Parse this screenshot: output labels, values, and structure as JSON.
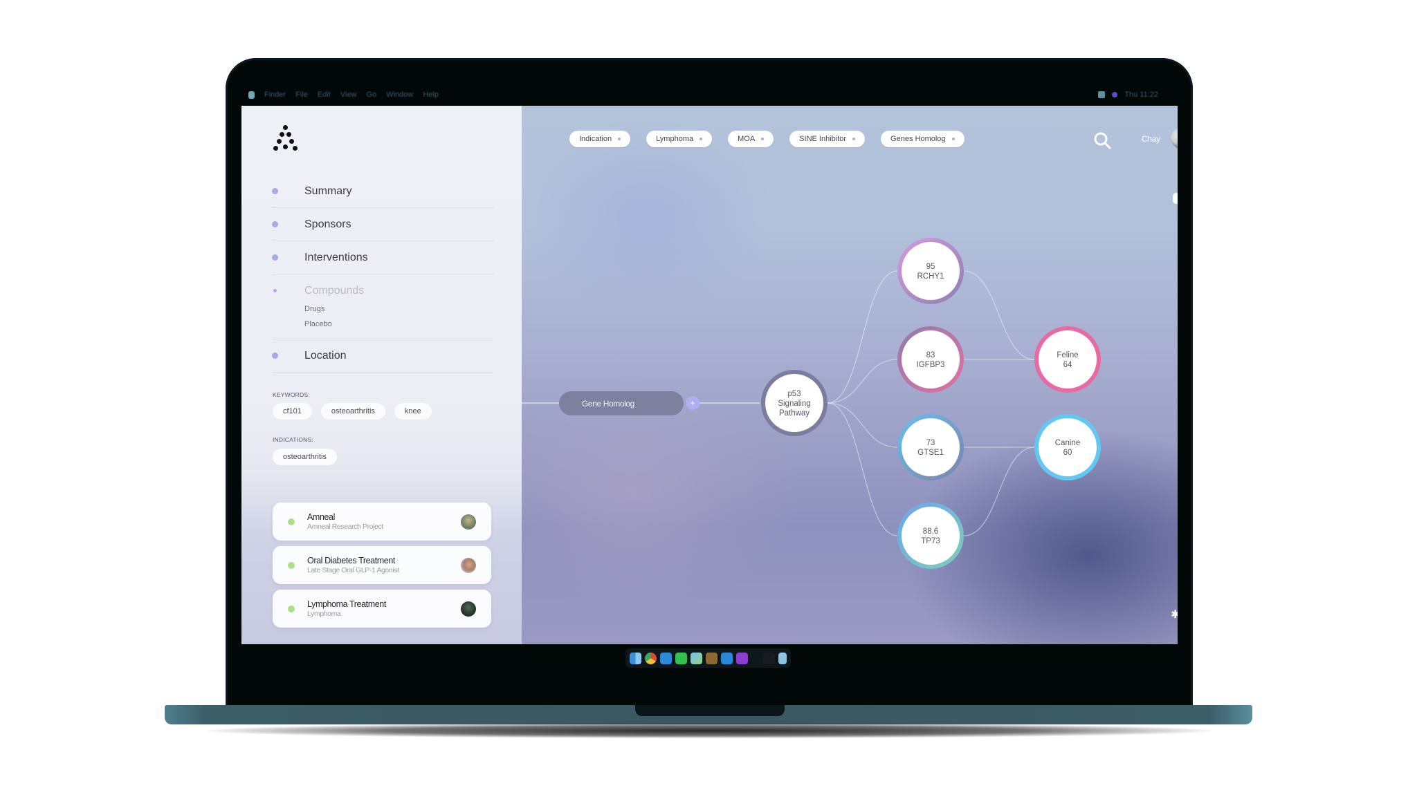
{
  "menubar": {
    "items": [
      "Finder",
      "File",
      "Edit",
      "View",
      "Go",
      "Window",
      "Help"
    ],
    "clock": "Thu 11:22"
  },
  "sidebar": {
    "logo": "dots-triangle-logo",
    "nav": [
      {
        "label": "Summary",
        "active": true
      },
      {
        "label": "Sponsors",
        "active": true
      },
      {
        "label": "Interventions",
        "active": true
      },
      {
        "label": "Compounds",
        "active": false,
        "children": [
          "Drugs",
          "Placebo"
        ]
      },
      {
        "label": "Location",
        "active": true
      }
    ],
    "keywords_label": "KEYWORDS:",
    "keywords": [
      "cf101",
      "osteoarthritis",
      "knee"
    ],
    "indications_label": "INDICATIONS:",
    "indications": [
      "osteoarthritis"
    ],
    "projects": [
      {
        "title": "Amneal",
        "subtitle": "Amneal Research Project",
        "status_color": "#aee08a"
      },
      {
        "title": "Oral Diabetes Treatment",
        "subtitle": "Late Stage Oral GLP-1 Agonist",
        "status_color": "#aee08a"
      },
      {
        "title": "Lymphoma Treatment",
        "subtitle": "Lymphoma",
        "status_color": "#aee08a"
      }
    ]
  },
  "header": {
    "filters": [
      "Indication",
      "Lymphoma",
      "MOA",
      "SINE Inhibitor",
      "Genes Homolog"
    ],
    "search_icon": "search-icon",
    "user_name": "Chay"
  },
  "graph": {
    "source_pill": "Gene Homolog",
    "root": {
      "lines": [
        "p53",
        "Signaling",
        "Pathway"
      ]
    },
    "genes": [
      {
        "id": "rchy1",
        "score": "95",
        "name": "RCHY1",
        "ring": [
          "#d59be0",
          "#8d7fb0"
        ]
      },
      {
        "id": "igfbp3",
        "score": "83",
        "name": "IGFBP3",
        "ring": [
          "#8f7ea8",
          "#e46ea4"
        ]
      },
      {
        "id": "gtse1",
        "score": "73",
        "name": "GTSE1",
        "ring": [
          "#64c2ec",
          "#7c82aa"
        ]
      },
      {
        "id": "tp73",
        "score": "88.6",
        "name": "TP73",
        "ring": [
          "#6aa6ee",
          "#7fcdb8"
        ]
      }
    ],
    "species": [
      {
        "id": "feline",
        "name": "Feline",
        "score": "64",
        "ring": [
          "#e76aa0",
          "#e76aa0"
        ]
      },
      {
        "id": "canine",
        "name": "Canine",
        "score": "60",
        "ring": [
          "#62c8f2",
          "#62c8f2"
        ]
      }
    ],
    "edges_to_species": [
      [
        "rchy1",
        "feline"
      ],
      [
        "igfbp3",
        "feline"
      ],
      [
        "gtse1",
        "canine"
      ],
      [
        "tp73",
        "canine"
      ]
    ]
  },
  "dock": {
    "apps": [
      "finder",
      "chrome",
      "mail",
      "messages",
      "maps",
      "notes",
      "keynote",
      "podcasts",
      "xd",
      "trash"
    ]
  }
}
